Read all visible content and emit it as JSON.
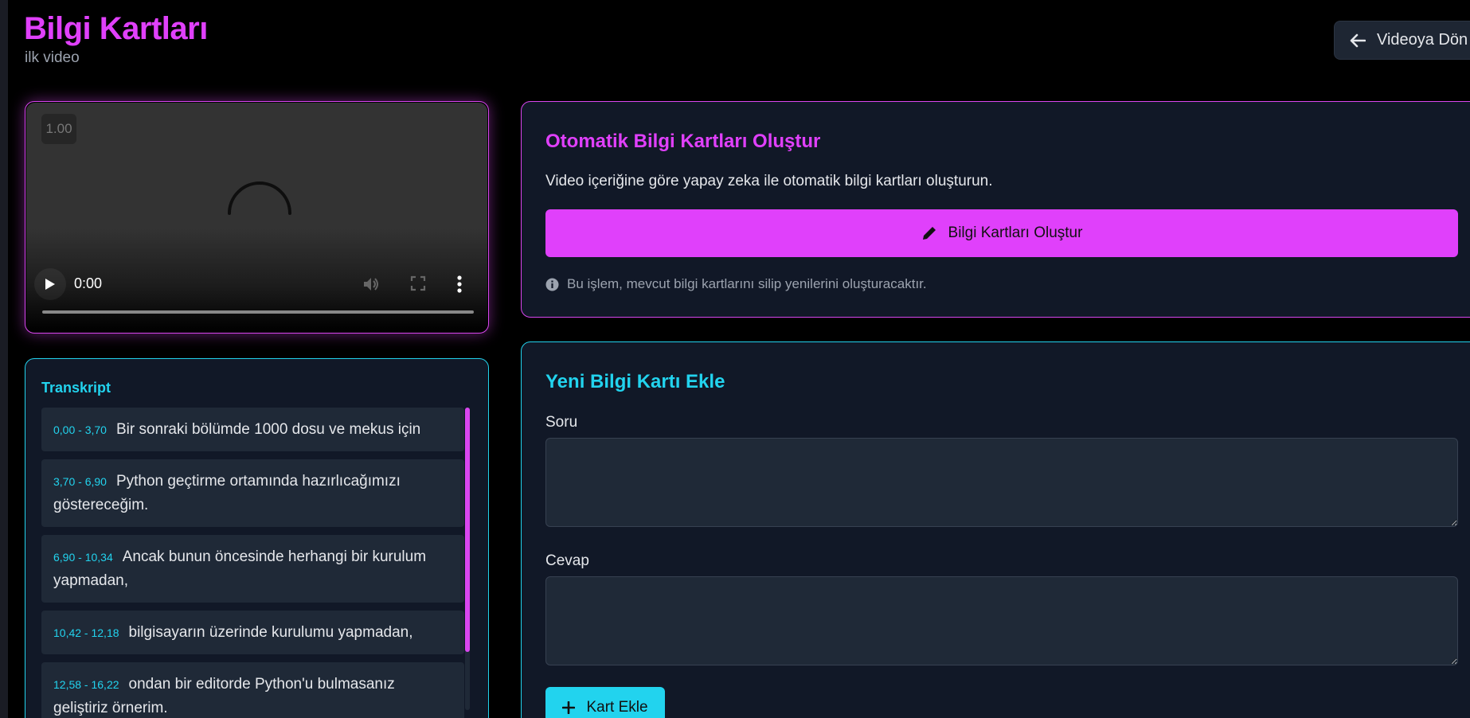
{
  "header": {
    "title": "Bilgi Kartları",
    "subtitle": "ilk video",
    "back_label": "Videoya Dön"
  },
  "video": {
    "speed": "1.00",
    "time": "0:00",
    "progress": 0
  },
  "transcript": {
    "title": "Transkript",
    "segments": [
      {
        "time": "0,00 - 3,70",
        "text": "Bir sonraki bölümde 1000 dosu ve mekus için"
      },
      {
        "time": "3,70 - 6,90",
        "text": "Python geçtirme ortamında hazırlıcağımızı göstereceğim."
      },
      {
        "time": "6,90 - 10,34",
        "text": "Ancak bunun öncesinde herhangi bir kurulum yapmadan,"
      },
      {
        "time": "10,42 - 12,18",
        "text": "bilgisayarın üzerinde kurulumu yapmadan,"
      },
      {
        "time": "12,58 - 16,22",
        "text": "ondan bir editorde Python'u bulmasanız geliştiriz örnerim."
      }
    ]
  },
  "auto": {
    "title": "Otomatik Bilgi Kartları Oluştur",
    "description": "Video içeriğine göre yapay zeka ile otomatik bilgi kartları oluşturun.",
    "button_label": "Bilgi Kartları Oluştur",
    "note": "Bu işlem, mevcut bilgi kartlarını silip yenilerini oluşturacaktır."
  },
  "new_card": {
    "title": "Yeni Bilgi Kartı Ekle",
    "question_label": "Soru",
    "question_value": "",
    "answer_label": "Cevap",
    "answer_value": "",
    "add_label": "Kart Ekle"
  },
  "colors": {
    "accent_magenta": "#e040fb",
    "accent_cyan": "#22d3ee",
    "card_bg": "#111827"
  }
}
